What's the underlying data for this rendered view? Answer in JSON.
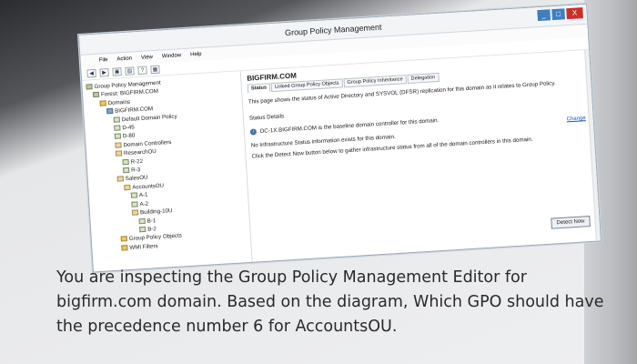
{
  "window": {
    "title": "Group Policy Management",
    "controls": {
      "minimize": "_",
      "maximize": "□",
      "close": "X"
    }
  },
  "menubar": [
    "File",
    "Action",
    "View",
    "Window",
    "Help"
  ],
  "toolbar": [
    "◀",
    "▶",
    "▣",
    "▤",
    "?",
    "▦"
  ],
  "tree": [
    {
      "label": "Group Policy Management",
      "icon": "gpm-icon",
      "depth": 0
    },
    {
      "label": "Forest: BIGFIRM.COM",
      "icon": "forest-icon",
      "depth": 1
    },
    {
      "label": "Domains",
      "icon": "folder-icon",
      "depth": 2
    },
    {
      "label": "BIGFIRM.COM",
      "icon": "domain-icon",
      "depth": 3
    },
    {
      "label": "Default Domain Policy",
      "icon": "gpo-icon",
      "depth": 4
    },
    {
      "label": "D-45",
      "icon": "gpo-icon",
      "depth": 4
    },
    {
      "label": "D-80",
      "icon": "gpo-icon",
      "depth": 4
    },
    {
      "label": "Domain Controllers",
      "icon": "ou-icon",
      "depth": 4
    },
    {
      "label": "ResearchOU",
      "icon": "ou-icon",
      "depth": 4
    },
    {
      "label": "R-22",
      "icon": "gpo-icon",
      "depth": 5
    },
    {
      "label": "R-3",
      "icon": "gpo-icon",
      "depth": 5
    },
    {
      "label": "SalesOU",
      "icon": "ou-icon",
      "depth": 4
    },
    {
      "label": "AccountsOU",
      "icon": "ou-icon",
      "depth": 5
    },
    {
      "label": "A-1",
      "icon": "gpo-icon",
      "depth": 6
    },
    {
      "label": "A-2",
      "icon": "gpo-icon",
      "depth": 6
    },
    {
      "label": "Building-10U",
      "icon": "ou-icon",
      "depth": 6
    },
    {
      "label": "B-1",
      "icon": "gpo-icon",
      "depth": 7
    },
    {
      "label": "B-2",
      "icon": "gpo-icon",
      "depth": 7
    },
    {
      "label": "Group Policy Objects",
      "icon": "folder-icon",
      "depth": 4
    },
    {
      "label": "WMI Filters",
      "icon": "folder-icon",
      "depth": 4
    }
  ],
  "content": {
    "heading": "BIGFIRM.COM",
    "tabs": [
      "Status",
      "Linked Group Policy Objects",
      "Group Policy Inheritance",
      "Delegation"
    ],
    "description": "This page shows the status of Active Directory and SYSVOL (DFSR) replication for this domain as it relates to Group Policy.",
    "status_details_label": "Status Details",
    "baseline_text": "DC-1X.BIGFIRM.COM is the baseline domain controller for this domain.",
    "change_link": "Change",
    "no_info_text": "No Infrastructure Status information exists for this domain.",
    "detect_instructions": "Click the Detect Now button below to gather infrastructure status from all of the domain controllers in this domain.",
    "detect_button": "Detect Now"
  },
  "question": "You are inspecting the Group Policy Management Editor for bigfirm.com domain. Based on the diagram, Which GPO should have the precedence number 6 for AccountsOU."
}
